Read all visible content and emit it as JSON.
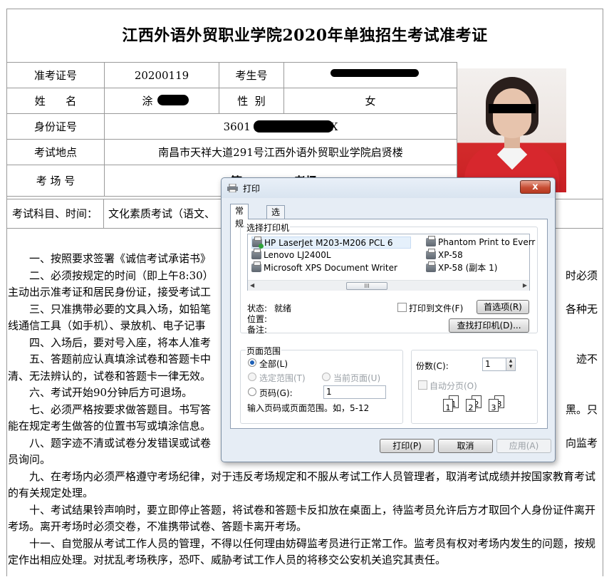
{
  "doc": {
    "title": "江西外语外贸职业学院2020年单独招生考试准考证",
    "labels": {
      "admit_no": "准考证号",
      "exam_no": "考生号",
      "name": "姓      名",
      "gender": "性  别",
      "id_no": "身份证号",
      "location": "考试地点",
      "room": "考 场 号",
      "subject": "考试科目、时间："
    },
    "values": {
      "admit_no": "20200119",
      "name_prefix": "涂",
      "gender": "女",
      "id_prefix": "3601",
      "id_suffix": "X",
      "location": "南昌市天祥大道291号江西外语外贸职业学院启贤楼",
      "room_prefix": "第",
      "room_suffix": "考场",
      "subject": "文化素质考试（语文、"
    },
    "rules": [
      "一、按照要求签署《诚信考试承诺书》",
      "二、必须按规定的时间（即上午8:30）",
      "时必须",
      "主动出示准考证和居民身份证，接受考试工",
      "三、只准携带必要的文具入场，如铅笔",
      "各种无",
      "线通信工具（如手机）、录放机、电子记事",
      "四、入场后，要对号入座，将本人准考",
      "五、答题前应认真填涂试卷和答题卡中",
      "迹不",
      "清、无法辨认的，试卷和答题卡一律无效。",
      "六、考试开始90分钟后方可退场。",
      "七、必须严格按要求做答题目。书写答",
      "黑。只",
      "能在规定考生做答的位置书写或填涂信息。",
      "八、题字迹不清或试卷分发错误或试卷",
      "向监考",
      "员询问。",
      "九、在考场内必须严格遵守考场纪律，对于违反考场规定和不服从考试工作人员管理者，取消考试成绩并按国家教育考试的有关规定处理。",
      "十、考试结果铃声响时，要立即停止答题，将试卷和答题卡反扣放在桌面上，待监考员允许后方才取回个人身份证件离开考场。离开考场时必须交卷，不准携带试卷、答题卡离开考场。",
      "十一、自觉服从考试工作人员的管理，不得以任何理由妨碍监考员进行正常工作。监考员有权对考场内发生的问题，按规定作出相应处理。对扰乱考场秩序，恐吓、威胁考试工作人员的将移交公安机关追究其责任。"
    ]
  },
  "dialog": {
    "title": "打印",
    "close": "x",
    "tabs": [
      "常规",
      "选项"
    ],
    "select_printer_label": "选择打印机",
    "printers": [
      "HP LaserJet M203-M206 PCL 6",
      "Lenovo LJ2400L",
      "Microsoft XPS Document Writer",
      "Phantom Print to Everr",
      "XP-58",
      "XP-58 (副本 1)"
    ],
    "scroll_thumb": "III",
    "status_label": "状态:",
    "status_value": "就绪",
    "location_label": "位置:",
    "comment_label": "备注:",
    "print_to_file": "打印到文件(F)",
    "preferences_btn": "首选项(R)",
    "find_printer_btn": "查找打印机(D)...",
    "page_range_label": "页面范围",
    "range_all": "全部(L)",
    "range_selection": "选定范围(T)",
    "range_current": "当前页面(U)",
    "range_pages": "页码(G):",
    "pages_value": "1",
    "range_hint": "输入页码或页面范围。如，5-12",
    "copies_label": "份数(C):",
    "copies_value": "1",
    "collate": "自动分页(O)",
    "collate_pages": [
      "1",
      "1",
      "2",
      "2",
      "3",
      "3"
    ],
    "print_btn": "打印(P)",
    "cancel_btn": "取消",
    "apply_btn": "应用(A)"
  }
}
